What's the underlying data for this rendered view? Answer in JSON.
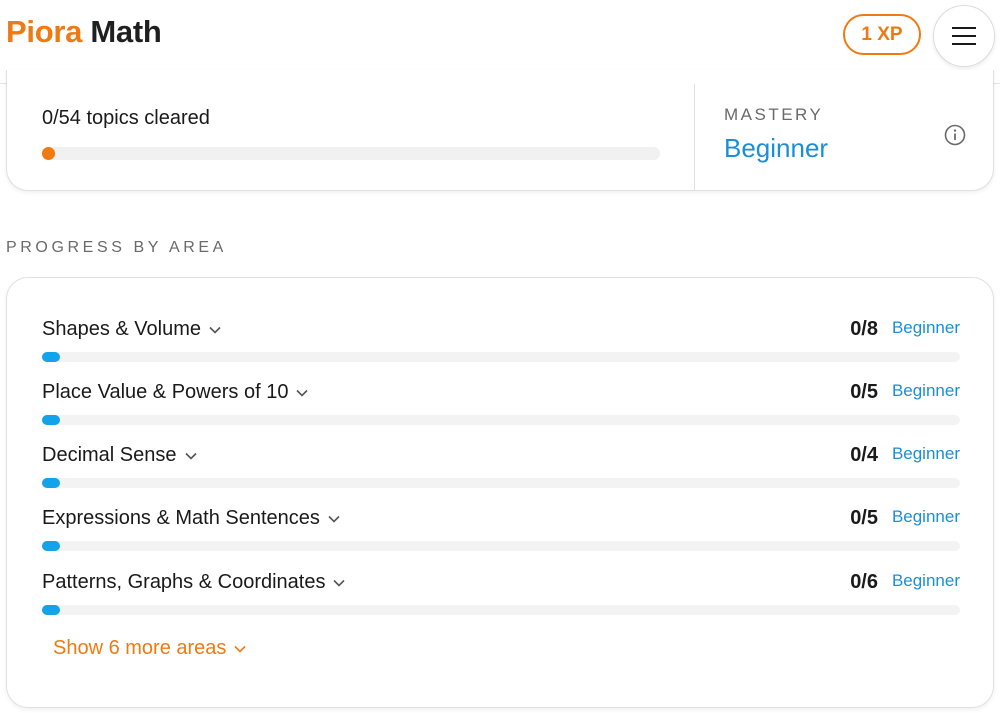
{
  "header": {
    "brand": "Piora",
    "product": "Math",
    "xp": "1 XP",
    "menu_icon": "hamburger-menu-icon"
  },
  "summary": {
    "topics_cleared": "0/54 topics cleared",
    "progress_fraction": 0,
    "mastery_label": "MASTERY",
    "mastery_value": "Beginner",
    "info_icon": "info-icon"
  },
  "progress_by_area": {
    "title": "PROGRESS BY AREA",
    "areas": [
      {
        "name": "Shapes & Volume",
        "count": "0/8",
        "level": "Beginner",
        "progress_fraction": 0
      },
      {
        "name": "Place Value & Powers of 10",
        "count": "0/5",
        "level": "Beginner",
        "progress_fraction": 0
      },
      {
        "name": "Decimal Sense",
        "count": "0/4",
        "level": "Beginner",
        "progress_fraction": 0
      },
      {
        "name": "Expressions & Math Sentences",
        "count": "0/5",
        "level": "Beginner",
        "progress_fraction": 0
      },
      {
        "name": "Patterns, Graphs & Coordinates",
        "count": "0/6",
        "level": "Beginner",
        "progress_fraction": 0
      }
    ],
    "show_more": "Show 6 more areas"
  },
  "colors": {
    "brand_orange": "#f07a12",
    "accent_blue": "#1a8fd6",
    "area_bar_blue": "#12a3ea"
  }
}
